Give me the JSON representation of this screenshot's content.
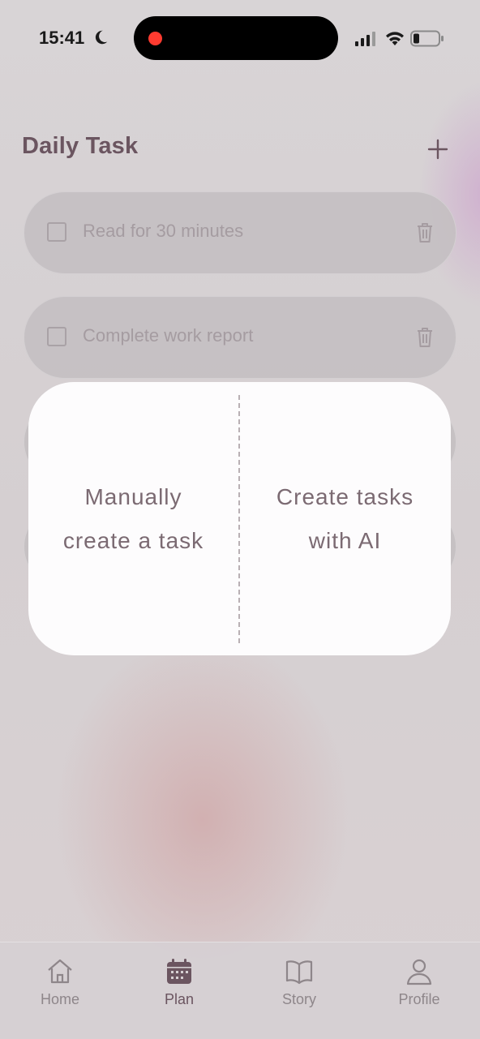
{
  "status_bar": {
    "time": "15:41",
    "moon_icon": "moon-icon",
    "recording_color": "#ff3b30"
  },
  "header": {
    "title": "Daily Task",
    "add_icon": "plus-icon"
  },
  "tasks": [
    {
      "label": "Read for 30 minutes",
      "checked": false
    },
    {
      "label": "Complete work report",
      "checked": false
    }
  ],
  "popup": {
    "manual_option": "Manually\ncreate a task",
    "ai_option": "Create tasks\nwith AI"
  },
  "tabbar": {
    "items": [
      {
        "label": "Home",
        "icon": "home-icon",
        "active": false
      },
      {
        "label": "Plan",
        "icon": "calendar-icon",
        "active": true
      },
      {
        "label": "Story",
        "icon": "book-icon",
        "active": false
      },
      {
        "label": "Profile",
        "icon": "person-icon",
        "active": false
      }
    ]
  },
  "colors": {
    "accent": "#6b5560",
    "popup_text": "#7b6a72",
    "muted_text": "#a59ca1"
  }
}
